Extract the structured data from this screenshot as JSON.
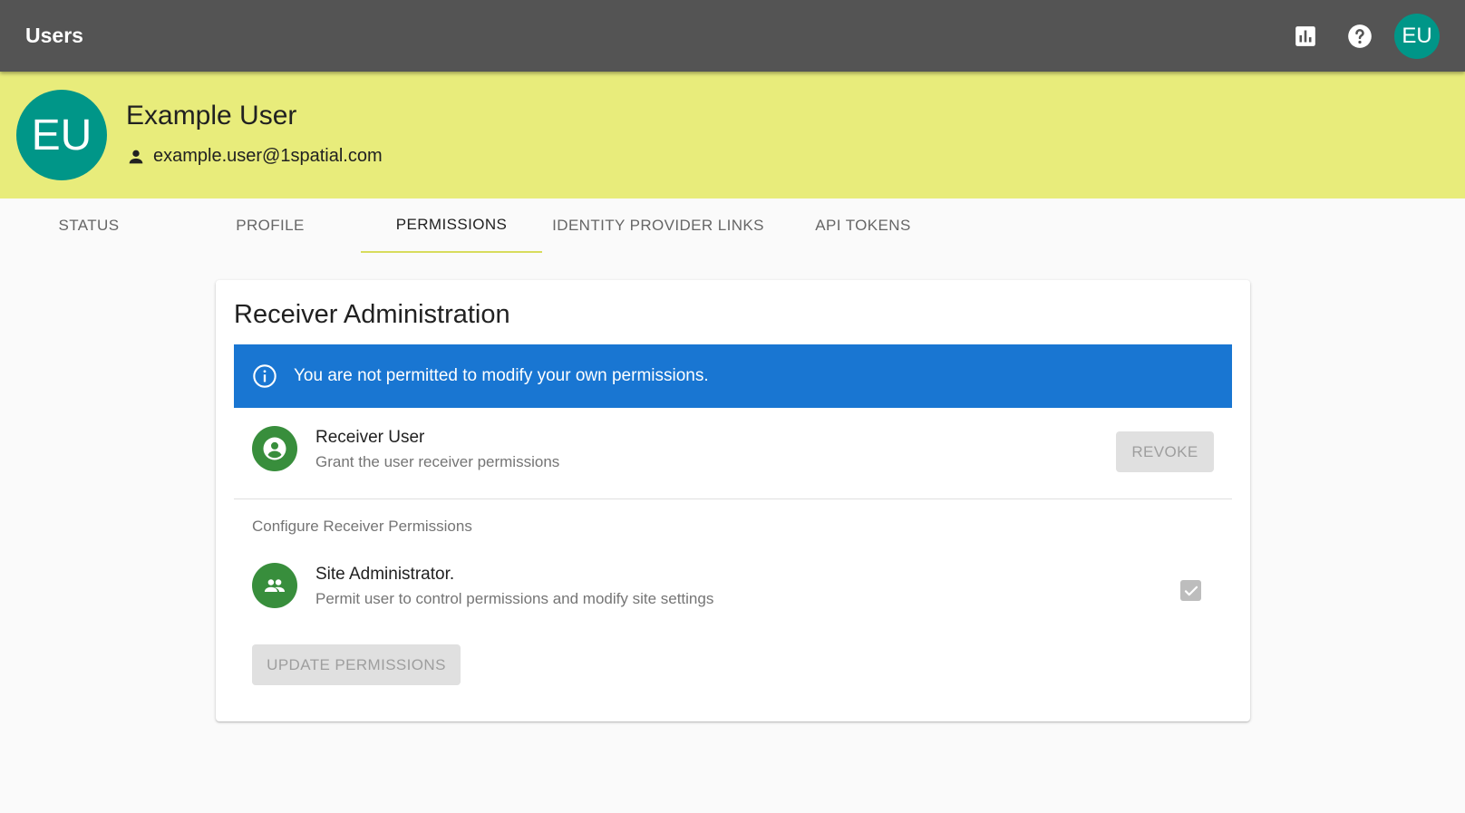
{
  "header": {
    "title": "Users",
    "analytics_icon": "bar-chart-icon",
    "help_icon": "help-circle-icon",
    "avatar_initials": "EU"
  },
  "profile": {
    "avatar_initials": "EU",
    "name": "Example User",
    "email": "example.user@1spatial.com",
    "email_icon": "person-icon"
  },
  "tabs": [
    {
      "label": "STATUS",
      "active": false
    },
    {
      "label": "PROFILE",
      "active": false
    },
    {
      "label": "PERMISSIONS",
      "active": true
    },
    {
      "label": "IDENTITY PROVIDER LINKS",
      "active": false
    },
    {
      "label": "API TOKENS",
      "active": false
    }
  ],
  "card": {
    "title": "Receiver Administration",
    "alert": {
      "icon": "info-icon",
      "text": "You are not permitted to modify your own permissions."
    },
    "receiver_user": {
      "icon": "account-circle-icon",
      "title": "Receiver User",
      "subtitle": "Grant the user receiver permissions",
      "revoke_label": "REVOKE"
    },
    "section_label": "Configure Receiver Permissions",
    "site_admin": {
      "icon": "group-icon",
      "title": "Site Administrator.",
      "subtitle": "Permit user to control permissions and modify site settings",
      "checked": true
    },
    "update_label": "UPDATE PERMISSIONS"
  },
  "colors": {
    "topbar": "#545454",
    "banner": "#e8ec7b",
    "avatar": "#009688",
    "alert": "#1976d2",
    "perm_icon": "#388e3c"
  }
}
